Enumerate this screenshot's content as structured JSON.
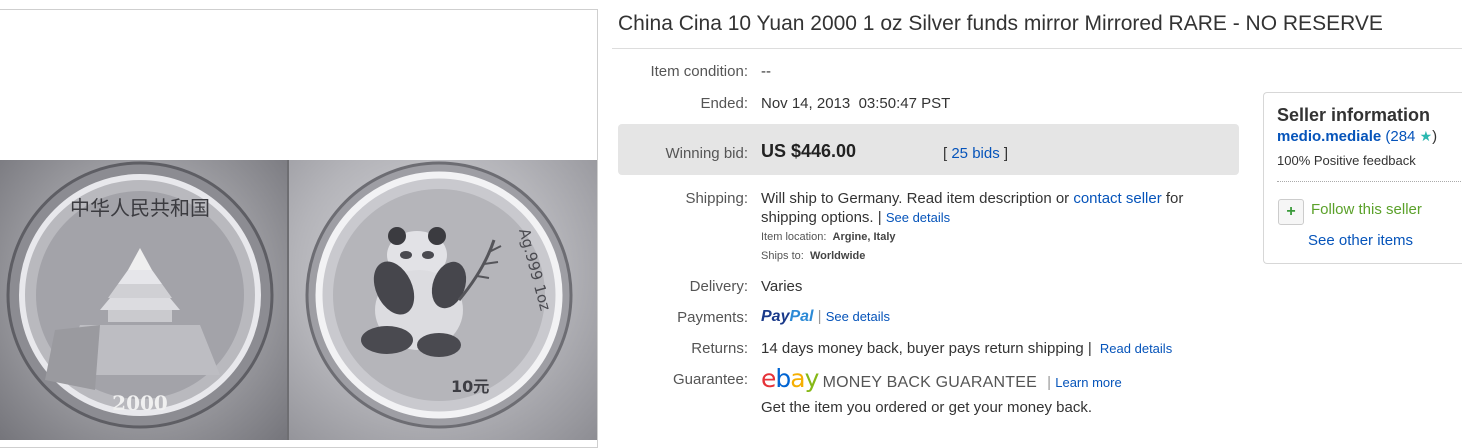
{
  "title": "China Cina 10 Yuan 2000 1 oz Silver funds mirror Mirrored RARE - NO RESERVE",
  "item_condition": {
    "label": "Item condition:",
    "value": "--"
  },
  "ended": {
    "label": "Ended:",
    "value": "Nov 14, 2013  03:50:47 PST"
  },
  "winning_bid": {
    "label": "Winning bid:",
    "amount": "US $446.00",
    "bids_open": "[",
    "bids_link": "25 bids",
    "bids_close": "]"
  },
  "shipping": {
    "label": "Shipping:",
    "line1_pre": "Will ship to Germany. Read item description or",
    "contact_link": "contact seller",
    "line1_post": "for",
    "line2_pre": "shipping options. |",
    "see_details": "See details",
    "location_label": "Item location:",
    "location_value": "Argine, Italy",
    "ships_to_label": "Ships to:",
    "ships_to_value": "Worldwide"
  },
  "delivery": {
    "label": "Delivery:",
    "value": "Varies"
  },
  "payments": {
    "label": "Payments:",
    "paypal_pre": "Pay",
    "paypal_post": "Pal",
    "sep": "|",
    "see_details": "See details"
  },
  "returns": {
    "label": "Returns:",
    "value": "14 days money back, buyer pays return shipping |",
    "link": "Read details"
  },
  "guarantee": {
    "label": "Guarantee:",
    "ebay_e": "e",
    "ebay_b": "b",
    "ebay_a": "a",
    "ebay_y": "y",
    "mbg": "MONEY BACK GUARANTEE",
    "sep": "|",
    "learn_more": "Learn more",
    "note": "Get the item you ordered or get your money back."
  },
  "seller": {
    "title": "Seller information",
    "name": "medio.mediale",
    "score_open": "(284",
    "star": "★",
    "score_close": ")",
    "feedback": "100% Positive feedback",
    "follow": "Follow this seller",
    "plus": "+",
    "see_other": "See other items"
  },
  "coin_left": {
    "top_text": "中华人民共和国",
    "year": "2000"
  },
  "coin_right": {
    "edge_text": "Ag.999 1oz",
    "denom": "10元"
  },
  "colors": {
    "link": "#0654ba",
    "follow_green": "#5ba12a",
    "bid_box": "#e5e5e5"
  }
}
